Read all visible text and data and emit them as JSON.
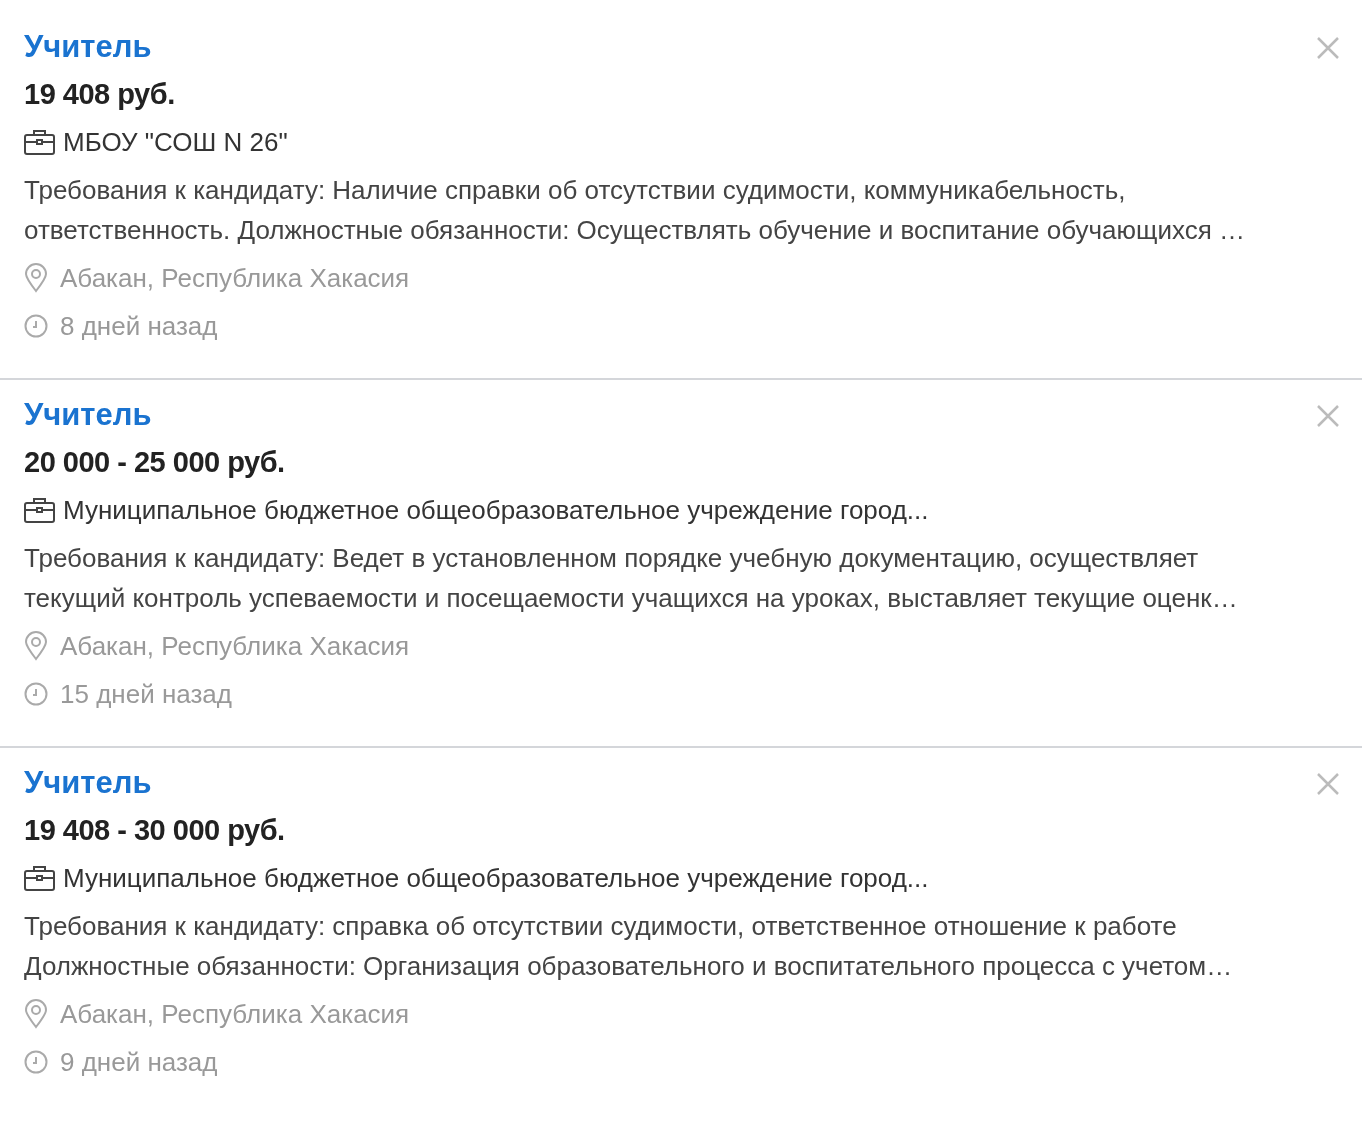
{
  "vacancies": [
    {
      "title": "Учитель",
      "salary": "19 408 руб.",
      "company": "МБОУ \"СОШ N 26\"",
      "description_lines": [
        "Требования к кандидату: Наличие справки об отсутствии судимости, коммуникабельность,",
        "ответственность. Должностные обязанности: Осуществлять обучение и воспитание обучающихся …"
      ],
      "location": "Абакан, Республика Хакасия",
      "posted": "8 дней назад"
    },
    {
      "title": "Учитель",
      "salary": "20 000 - 25 000 руб.",
      "company": "Муниципальное бюджетное общеобразовательное учреждение город...",
      "description_lines": [
        "Требования к кандидату: Ведет в установленном порядке учебную документацию, осуществляет",
        "текущий контроль успеваемости и посещаемости учащихся на уроках, выставляет текущие оценк…"
      ],
      "location": "Абакан, Республика Хакасия",
      "posted": "15 дней назад"
    },
    {
      "title": "Учитель",
      "salary": "19 408 - 30 000 руб.",
      "company": "Муниципальное бюджетное общеобразовательное учреждение город...",
      "description_lines": [
        "Требования к кандидату: справка об отсутствии судимости, ответственное отношение к работе",
        "Должностные обязанности: Организация образовательного и воспитательного процесса с учетом…"
      ],
      "location": "Абакан, Республика Хакасия",
      "posted": "9 дней назад"
    }
  ]
}
